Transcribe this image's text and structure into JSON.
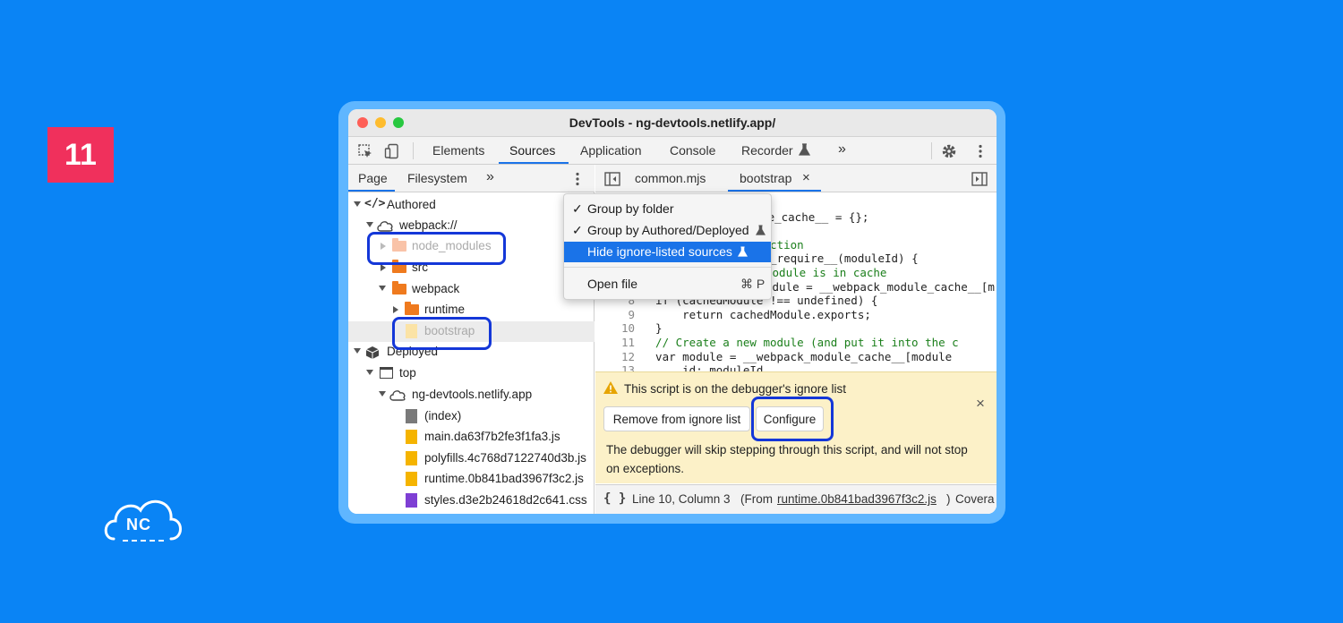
{
  "slide_number": "11",
  "logo_text": "NC",
  "window": {
    "title": "DevTools - ng-devtools.netlify.app/"
  },
  "toolbar": {
    "tabs": [
      "Elements",
      "Sources",
      "Application",
      "Console",
      "Recorder",
      "»"
    ],
    "active_tab": "Sources"
  },
  "navigator": {
    "tabs": [
      "Page",
      "Filesystem",
      "»"
    ],
    "tree": [
      {
        "label": "Authored"
      },
      {
        "label": "webpack://"
      },
      {
        "label": "node_modules"
      },
      {
        "label": "src"
      },
      {
        "label": "webpack"
      },
      {
        "label": "runtime"
      },
      {
        "label": "bootstrap"
      },
      {
        "label": "Deployed"
      },
      {
        "label": "top"
      },
      {
        "label": "ng-devtools.netlify.app"
      },
      {
        "label": "(index)"
      },
      {
        "label": "main.da63f7b2fe3f1fa3.js"
      },
      {
        "label": "polyfills.4c768d7122740d3b.js"
      },
      {
        "label": "runtime.0b841bad3967f3c2.js"
      },
      {
        "label": "styles.d3e2b24618d2c641.css"
      }
    ]
  },
  "editor": {
    "tabs": [
      "common.mjs",
      "bootstrap"
    ],
    "close_glyph": "×",
    "code_lines": [
      {
        "num": "",
        "text": "che"
      },
      {
        "num": "",
        "text": "dule_cache__ = {};"
      },
      {
        "num": "",
        "text": ""
      },
      {
        "num": "",
        "text": "unction"
      },
      {
        "num": "",
        "text": "ck_require__(moduleId) {"
      },
      {
        "num": "",
        "text": "module is in cache"
      },
      {
        "num": "",
        "text": "odule = __webpack_module_cache__[m"
      },
      {
        "num": "8",
        "text": "  if (cachedModule !== undefined) {"
      },
      {
        "num": "9",
        "text": "      return cachedModule.exports;"
      },
      {
        "num": "10",
        "text": "  }"
      },
      {
        "num": "11",
        "text": "  // Create a new module (and put it into the c"
      },
      {
        "num": "12",
        "text": "  var module = __webpack_module_cache__[module"
      },
      {
        "num": "13",
        "text": "      id: moduleId"
      }
    ]
  },
  "context_menu": {
    "items": [
      {
        "check": "✓",
        "label": "Group by folder"
      },
      {
        "check": "✓",
        "label": "Group by Authored/Deployed"
      },
      {
        "check": "",
        "label": "Hide ignore-listed sources"
      },
      {
        "check": "",
        "label": "Open file",
        "shortcut": "⌘ P"
      }
    ]
  },
  "infobar": {
    "message": "This script is on the debugger's ignore list",
    "remove_button": "Remove from ignore list",
    "configure_button": "Configure",
    "close_glyph": "×",
    "details": "The debugger will skip stepping through this script, and will not stop on exceptions."
  },
  "statusbar": {
    "braces": "{ }",
    "position": "Line 10, Column 3",
    "from_prefix": "(From ",
    "from_file": "runtime.0b841bad3967f3c2.js",
    "from_suffix": ")",
    "coverage": "Covera"
  },
  "colors": {
    "background": "#0a84f5",
    "badge": "#f0305c",
    "highlight_box": "#1437d8",
    "accent": "#1a73e8",
    "infobar": "#fcf1c8"
  }
}
